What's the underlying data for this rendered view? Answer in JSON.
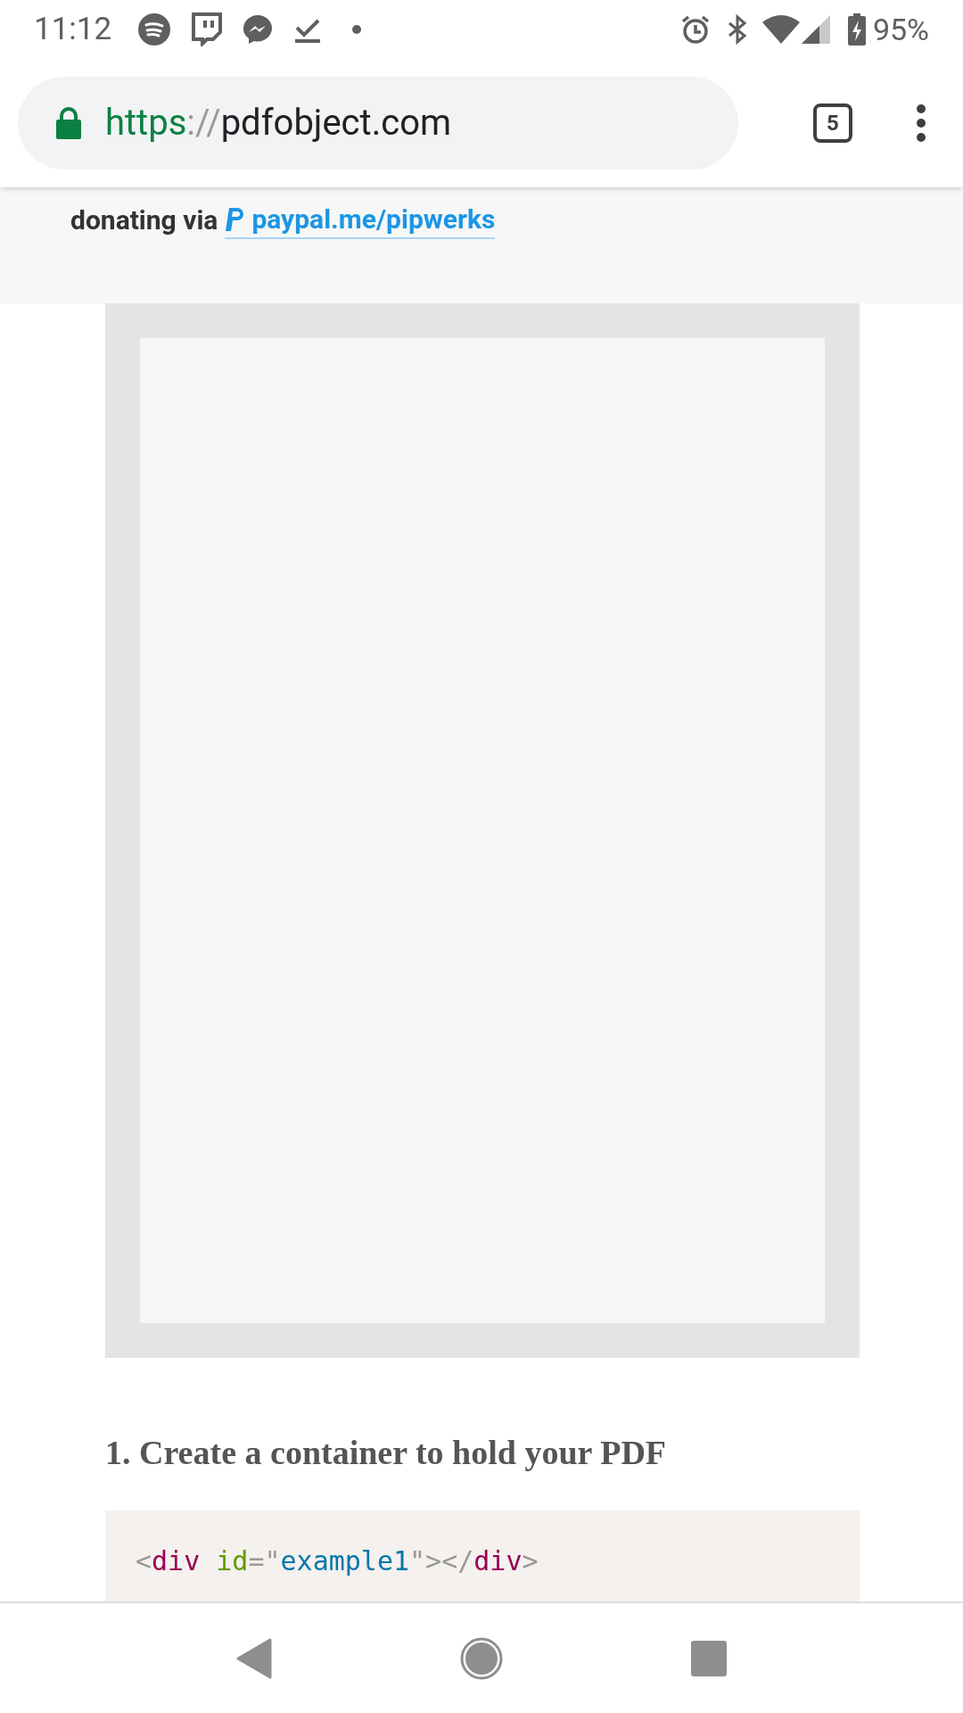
{
  "status_bar": {
    "time": "11:12",
    "battery": "95%"
  },
  "address_bar": {
    "scheme": "https",
    "separator": "://",
    "host": "pdfobject.com",
    "secure": true
  },
  "tab_count": "5",
  "intro": {
    "line_2_text": "donating via",
    "paypal_link": "paypal.me/pipwerks"
  },
  "pdf_viewer": {
    "kind": "empty"
  },
  "heading": "1. Create a container to hold your PDF",
  "code": [
    {
      "kind": "punct",
      "text": "<"
    },
    {
      "kind": "tag",
      "text": "div"
    },
    {
      "kind": "attr",
      "text": " id"
    },
    {
      "kind": "punct",
      "text": "=\""
    },
    {
      "kind": "string",
      "text": "example1"
    },
    {
      "kind": "punct",
      "text": "\"></"
    },
    {
      "kind": "tag",
      "text": "div"
    },
    {
      "kind": "punct",
      "text": ">"
    }
  ]
}
